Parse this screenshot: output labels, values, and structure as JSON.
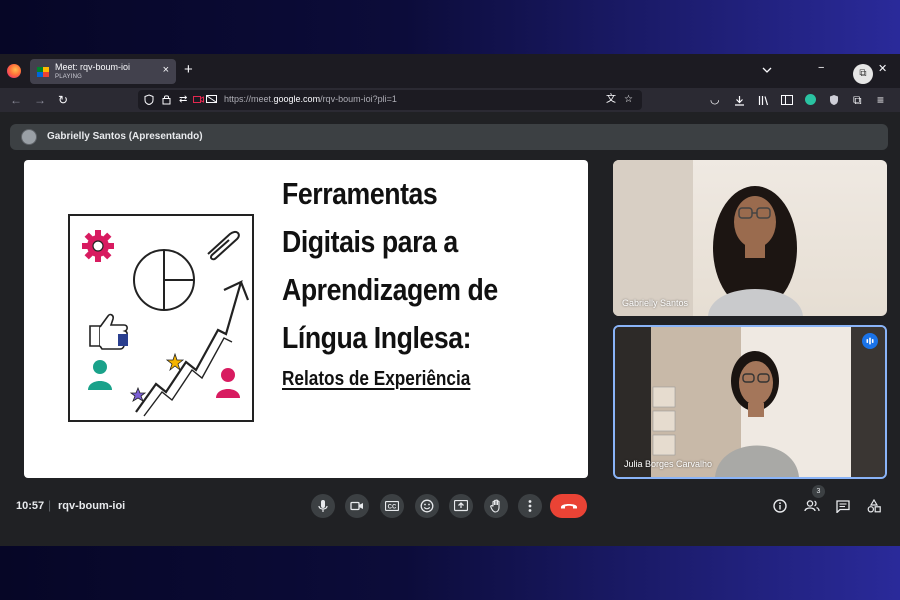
{
  "browser": {
    "tab": {
      "title": "Meet: rqv-boum-ioi",
      "status": "PLAYING",
      "close": "×"
    },
    "new_tab": "+",
    "window": {
      "minimize": "−",
      "close": "✕"
    },
    "url": {
      "prefix": "https://meet.",
      "domain": "google.com",
      "path": "/rqv-boum-ioi?pli=1"
    }
  },
  "meet": {
    "presenter_label": "Gabrielly Santos (Apresentando)",
    "slide": {
      "title_lines": [
        "Ferramentas",
        "Digitais para a",
        "Aprendizagem de",
        "Língua Inglesa:"
      ],
      "subtitle": "Relatos de Experiência"
    },
    "participants": [
      {
        "name": "Gabrielly Santos",
        "speaking": false
      },
      {
        "name": "Julia Borges Carvalho",
        "speaking": true
      }
    ],
    "footer": {
      "time": "10:57",
      "separator": "|",
      "code": "rqv-boum-ioi",
      "participant_count": "3"
    }
  },
  "colors": {
    "meet_bg": "#202124",
    "control_bg": "#3c4043",
    "hangup": "#ea4335",
    "active_tile_border": "#8ab4f8"
  }
}
